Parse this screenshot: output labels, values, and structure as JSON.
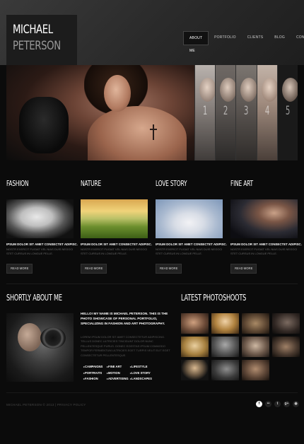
{
  "logo": {
    "line1": "MICHAEL",
    "line2": "PETERSON"
  },
  "nav": [
    {
      "label": "ABOUT ME",
      "active": true
    },
    {
      "label": "PORTFOLIO",
      "active": false
    },
    {
      "label": "CLIENTS",
      "active": false
    },
    {
      "label": "BLOG",
      "active": false
    },
    {
      "label": "CONTACTS",
      "active": false
    }
  ],
  "hero": {
    "thumb_numbers": [
      "1",
      "2",
      "3",
      "4",
      "5"
    ]
  },
  "categories": [
    {
      "title": "FASHION",
      "heading": "IPSUM DOLOR SIT AMET CONSECTET ADIPISC.",
      "body": "NOSTR EXERCIT FUGIAT VEL NIAS DUIS NEGOCI STET CURSUS IN LONGUE PELLE.",
      "button": "READ MORE"
    },
    {
      "title": "NATURE",
      "heading": "IPSUM DOLOR SIT AMET CONSECTET ADIPISC.",
      "body": "NOSTR EXERCIT FUGIAT VEL NIAS DUIS NEGOCI STET CURSUS IN LONGUE PELLE.",
      "button": "READ MORE"
    },
    {
      "title": "LOVE STORY",
      "heading": "IPSUM DOLOR SIT AMET CONSECTET ADIPISC.",
      "body": "NOSTR EXERCIT FUGIAT VEL NIAS DUIS NEGOCI STET CURSUS IN LONGUE PELLE.",
      "button": "READ MORE"
    },
    {
      "title": "FINE ART",
      "heading": "IPSUM DOLOR SIT AMET CONSECTET ADIPISC.",
      "body": "NOSTR EXERCIT FUGIAT VEL NIAS DUIS NEGOCI STET CURSUS IN LONGUE PELLE.",
      "button": "READ MORE"
    }
  ],
  "about": {
    "title": "SHORTLY ABOUT ME",
    "intro": "HELLO! MY NAME IS MICHAEL PETERSON. THIS IS THE PHOTO SHOWCASE OF PERSONAL PORTFOLIO, SPECIALIZING IN FASHION AND ART PHOTOGRAPHY.",
    "body": "LOREM IPSUM DOLOR SIT AMET CONSECTETUR ADIPISCING. TELLUS DONEC ULTRICIES TINCIDUNT DOLOR NUNC PELLENTESQUE PURUS. DONEC EGESTAS IPSUM COMMODO TEMPOR FERMENTUM ULTRICIES EGET TURPIS VELIT ELIT EGET CONSECTETUR PELLENTESQUE.",
    "tags": [
      "CAMPAIGNS",
      "FINE ART",
      "LIFESTYLE",
      "PORTRAITS",
      "MOTION",
      "LOVE STORY",
      "FASHION",
      "ADVERTISING",
      "LANDSCAPES"
    ]
  },
  "photoshoots": {
    "title": "LATEST PHOTOSHOOTS"
  },
  "footer": {
    "text": "MICHAEL PETERSON © 2013 | PRIVACY POLICY"
  },
  "social": [
    {
      "icon": "facebook-icon",
      "glyph": "f"
    },
    {
      "icon": "flickr-icon",
      "glyph": "••"
    },
    {
      "icon": "twitter-icon",
      "glyph": "t"
    },
    {
      "icon": "google-plus-icon",
      "glyph": "g+"
    },
    {
      "icon": "rss-icon",
      "glyph": "◉"
    }
  ]
}
